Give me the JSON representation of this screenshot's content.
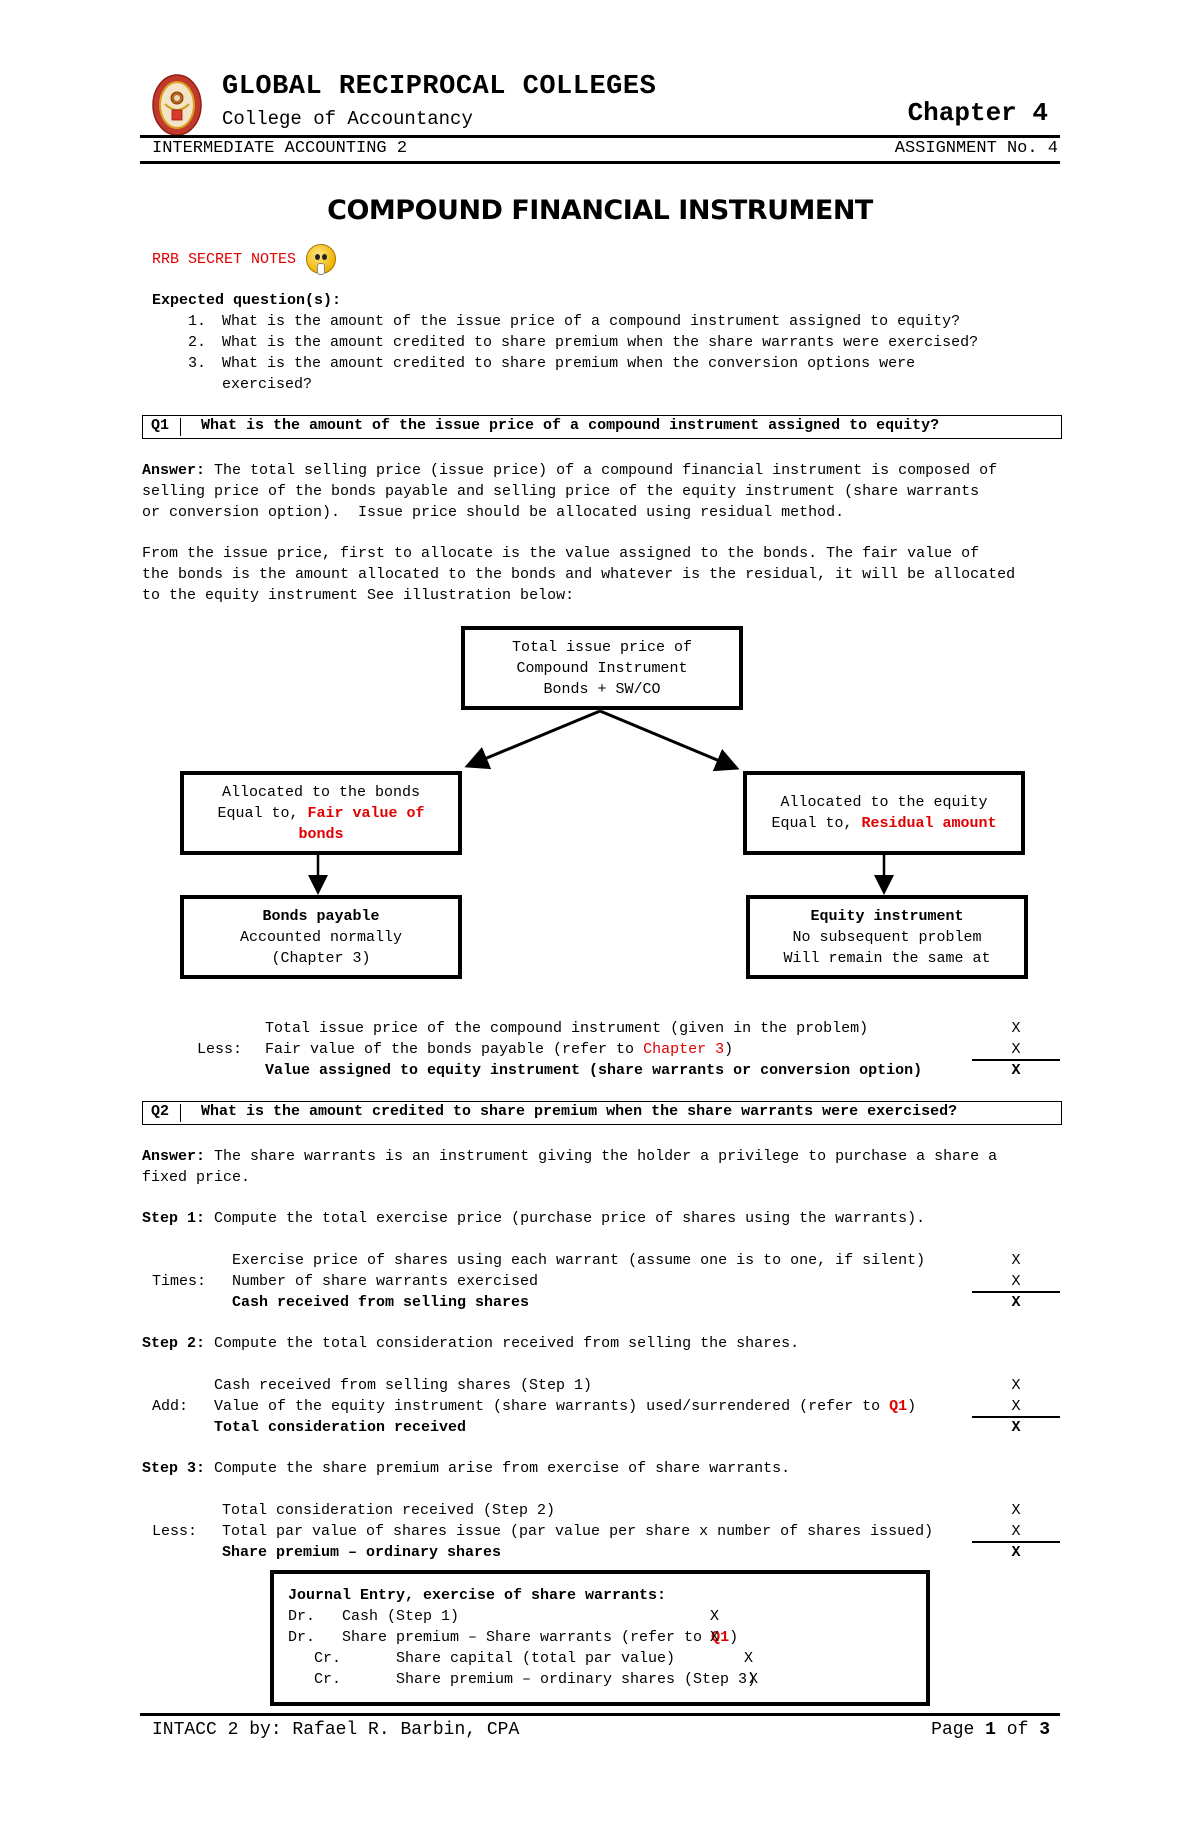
{
  "header": {
    "school_name": "GLOBAL RECIPROCAL COLLEGES",
    "college": "College of Accountancy",
    "chapter": "Chapter 4",
    "course": "INTERMEDIATE ACCOUNTING 2",
    "assignment": "ASSIGNMENT No. 4",
    "logo_icon": "college-seal-icon"
  },
  "title": "COMPOUND FINANCIAL INSTRUMENT",
  "secret_notes": {
    "label": "RRB SECRET NOTES",
    "icon": "shushing-face-emoji-icon"
  },
  "expected": {
    "heading": "Expected question(s):",
    "items": [
      {
        "num": "1.",
        "text": "What is the amount of the issue price of a compound instrument assigned to equity?"
      },
      {
        "num": "2.",
        "text": "What is the amount credited to share premium when the share warrants were exercised?"
      },
      {
        "num": "3.",
        "text": "What is the amount credited to share premium when the conversion options were"
      },
      {
        "num": "",
        "text": "exercised?"
      }
    ]
  },
  "q1": {
    "label": "Q1",
    "question": "What is the amount of the issue price of a compound instrument assigned to equity?",
    "answer_label": "Answer:",
    "answer_lines": [
      " The total selling price (issue price) of a compound financial instrument is composed of",
      "selling price of the bonds payable and selling price of the equity instrument (share warrants",
      "or conversion option).  Issue price should be allocated using residual method."
    ],
    "para2_lines": [
      "From the issue price, first to allocate is the value assigned to the bonds. The fair value of",
      "the bonds is the amount allocated to the bonds and whatever is the residual, it will be allocated",
      "to the equity instrument See illustration below:"
    ],
    "diagram": {
      "top": [
        "Total issue price of",
        "Compound Instrument",
        "Bonds + SW/CO"
      ],
      "left": {
        "line1": "Allocated to the bonds",
        "line2_prefix": "Equal to, ",
        "line2_red": "Fair value of",
        "line3_red": "bonds"
      },
      "right": {
        "line1": "Allocated to the equity",
        "line2_prefix": "Equal to, ",
        "line2_red": "Residual amount"
      },
      "bottom_left": {
        "title": "Bonds payable",
        "lines": [
          "Accounted normally",
          "(Chapter 3)"
        ]
      },
      "bottom_right": {
        "title": "Equity instrument",
        "lines": [
          "No subsequent problem",
          "Will remain the same at"
        ]
      }
    },
    "computation": {
      "rows": [
        {
          "prefix": "",
          "text": "Total issue price of the compound instrument (given in the problem)",
          "value": "X"
        },
        {
          "prefix": "Less:",
          "text": "Fair value of the bonds payable (refer to ",
          "red": "Chapter 3",
          "suffix": ")",
          "value": "X"
        },
        {
          "prefix": "",
          "text": "Value assigned to equity instrument (share warrants or conversion option)",
          "value": "X"
        }
      ]
    }
  },
  "q2": {
    "label": "Q2",
    "question": "What is the amount credited to share premium when the share warrants were exercised?",
    "answer_label": "Answer:",
    "answer_lines": [
      " The share warrants is an instrument giving the holder a privilege to purchase a share a",
      "fixed price."
    ],
    "step1": {
      "label": "Step 1:",
      "text": " Compute the total exercise price (purchase price of shares using the warrants).",
      "rows": [
        {
          "prefix": "",
          "text": "Exercise price of shares using each warrant (assume one is to one, if silent)",
          "value": "X"
        },
        {
          "prefix": "Times:",
          "text": "Number of share warrants exercised",
          "value": "X"
        },
        {
          "prefix": "",
          "text": "Cash received from selling shares",
          "value": "X"
        }
      ]
    },
    "step2": {
      "label": "Step 2:",
      "text": " Compute the total consideration received from selling the shares.",
      "rows": [
        {
          "prefix": "",
          "text": "Cash received from selling shares (Step 1)",
          "value": "X"
        },
        {
          "prefix": "Add:",
          "text": "Value of the equity instrument (share warrants) used/surrendered (refer to ",
          "red": "Q1",
          "suffix": ")",
          "value": "X"
        },
        {
          "prefix": "",
          "text": "Total consideration received",
          "value": "X"
        }
      ]
    },
    "step3": {
      "label": "Step 3:",
      "text": " Compute the share premium arise from exercise of share warrants.",
      "rows": [
        {
          "prefix": "",
          "text": "Total consideration received (Step 2)",
          "value": "X"
        },
        {
          "prefix": "Less:",
          "text": "Total par value of shares issue (par value per share x number of shares issued)",
          "value": "X"
        },
        {
          "prefix": "",
          "text": "Share premium – ordinary shares",
          "value": "X"
        }
      ]
    },
    "journal": {
      "heading": "Journal Entry, exercise of share warrants:",
      "entries": [
        {
          "side": "Dr.",
          "account": "Cash (Step 1)",
          "value": "X"
        },
        {
          "side": "Dr.",
          "account": "Share premium – Share warrants (refer to ",
          "red": "Q1",
          "suffix": ")",
          "value": "X"
        },
        {
          "side": "Cr.",
          "account": "Share capital (total par value)",
          "value": "X"
        },
        {
          "side": "Cr.",
          "account": "Share premium – ordinary shares (Step 3)",
          "value": "X"
        }
      ]
    }
  },
  "footer": {
    "author": "INTACC 2 by: Rafael R. Barbin, CPA",
    "page_prefix": "Page ",
    "page_num": "1",
    "page_of": " of ",
    "page_total": "3"
  }
}
